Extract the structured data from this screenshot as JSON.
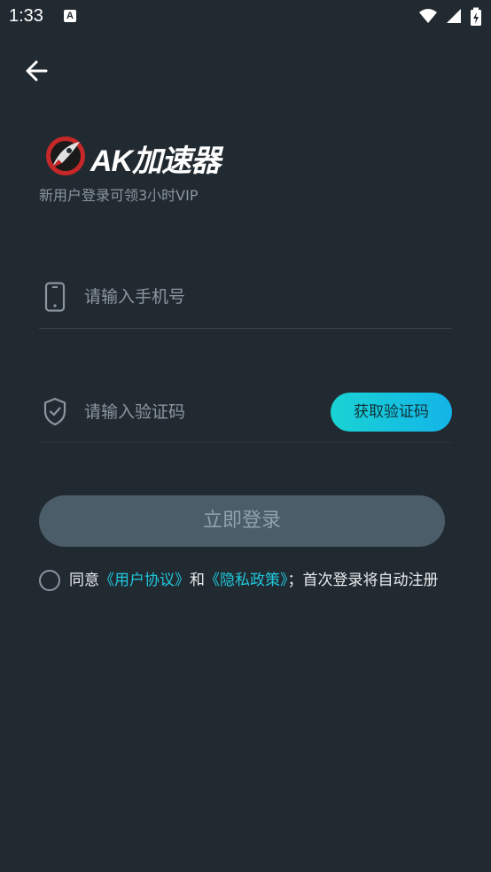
{
  "status_bar": {
    "time": "1:33",
    "notification_icon_letter": "A"
  },
  "header": {
    "back_icon": "arrow-left-icon"
  },
  "brand": {
    "logo_text": "AK加速器",
    "subtitle": "新用户登录可领3小时VIP",
    "accent_color": "#e53935"
  },
  "form": {
    "phone": {
      "placeholder": "请输入手机号",
      "value": "",
      "icon": "phone-icon"
    },
    "code": {
      "placeholder": "请输入验证码",
      "value": "",
      "icon": "shield-check-icon",
      "button_label": "获取验证码"
    },
    "login_label": "立即登录"
  },
  "agreement": {
    "prefix": "同意",
    "user_agreement": "《用户协议》",
    "and": "和",
    "privacy_policy": "《隐私政策》",
    "suffix": "；首次登录将自动注册",
    "checked": false,
    "link_color": "#1ec8dc"
  }
}
